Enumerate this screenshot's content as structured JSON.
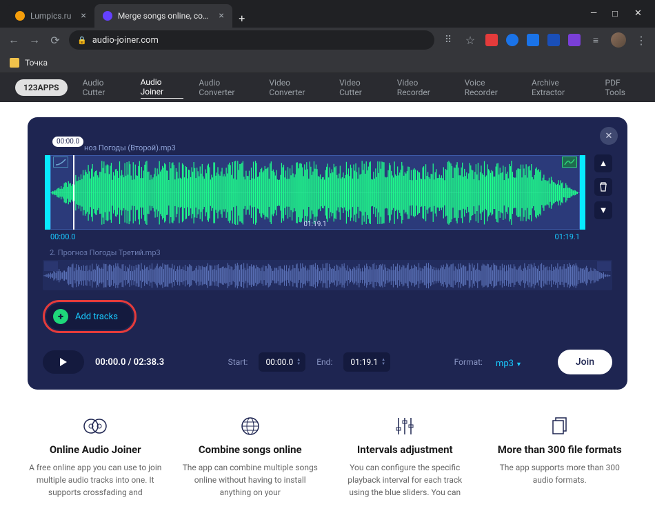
{
  "browser": {
    "tabs": [
      {
        "title": "Lumpics.ru",
        "iconColor": "#f59e0b"
      },
      {
        "title": "Merge songs online, combine m",
        "iconColor": "#6441ff"
      }
    ],
    "url": "audio-joiner.com",
    "bookmark": "Точка"
  },
  "header": {
    "brand": "123APPS",
    "nav": [
      "Audio Cutter",
      "Audio Joiner",
      "Audio Converter",
      "Video Converter",
      "Video Cutter",
      "Video Recorder",
      "Voice Recorder",
      "Archive Extractor",
      "PDF Tools"
    ]
  },
  "editor": {
    "tooltip": "00:00.0",
    "track1": {
      "filename": "ноз Погоды (Второй).mp3",
      "start": "00:00.0",
      "end": "01:19.1",
      "duration": "01:19.1"
    },
    "track2": {
      "filename": "2. Прогноз Погоды Третий.mp3"
    },
    "add_label": "Add tracks",
    "controls": {
      "playtime": "00:00.0 / 02:38.3",
      "start_label": "Start:",
      "start_value": "00:00.0",
      "end_label": "End:",
      "end_value": "01:19.1",
      "format_label": "Format:",
      "format_value": "mp3",
      "join_label": "Join"
    }
  },
  "features": [
    {
      "icon": "joiner",
      "title": "Online Audio Joiner",
      "desc": "A free online app you can use to join multiple audio tracks into one. It supports crossfading and"
    },
    {
      "icon": "globe",
      "title": "Combine songs online",
      "desc": "The app can combine multiple songs online without having to install anything on your"
    },
    {
      "icon": "sliders",
      "title": "Intervals adjustment",
      "desc": "You can configure the specific playback interval for each track using the blue sliders. You can"
    },
    {
      "icon": "files",
      "title": "More than 300 file formats",
      "desc": "The app supports more than 300 audio formats."
    }
  ]
}
